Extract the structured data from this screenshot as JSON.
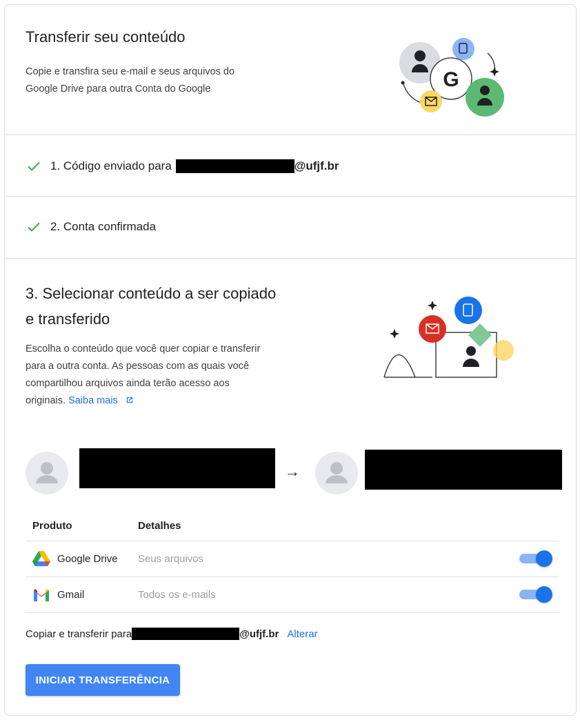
{
  "header": {
    "title": "Transferir seu conteúdo",
    "description_line1": "Copie e transfira seu e-mail e seus arquivos do",
    "description_line2": "Google Drive para outra Conta do Google"
  },
  "steps": [
    {
      "label": "1. Código enviado para",
      "email_suffix": "@ufjf.br",
      "status": "done"
    },
    {
      "label": "2. Conta confirmada",
      "status": "done"
    }
  ],
  "select_section": {
    "title_line1": "3. Selecionar conteúdo a ser copiado",
    "title_line2": "e transferido",
    "desc_line1": "Escolha o conteúdo que você quer copiar e transferir",
    "desc_line2": "para a outra conta. As pessoas com as quais você",
    "desc_line3": "compartilhou arquivos ainda terão acesso aos",
    "desc_line4": "originais.",
    "learn_more": "Saiba mais"
  },
  "transfer": {
    "arrow": "→"
  },
  "table": {
    "col_product": "Produto",
    "col_details": "Detalhes",
    "rows": [
      {
        "product": "Google Drive",
        "details": "Seus arquivos",
        "enabled": true,
        "icon": "google-drive-icon"
      },
      {
        "product": "Gmail",
        "details": "Todos os e-mails",
        "enabled": true,
        "icon": "gmail-icon"
      }
    ]
  },
  "copy_to": {
    "prefix": "Copiar e transferir para",
    "email_suffix": "@ufjf.br",
    "change_link": "Alterar"
  },
  "actions": {
    "start_button": "INICIAR TRANSFERÊNCIA"
  },
  "colors": {
    "accent": "#1a73e8",
    "button": "#4285f4",
    "check": "#34a853"
  }
}
